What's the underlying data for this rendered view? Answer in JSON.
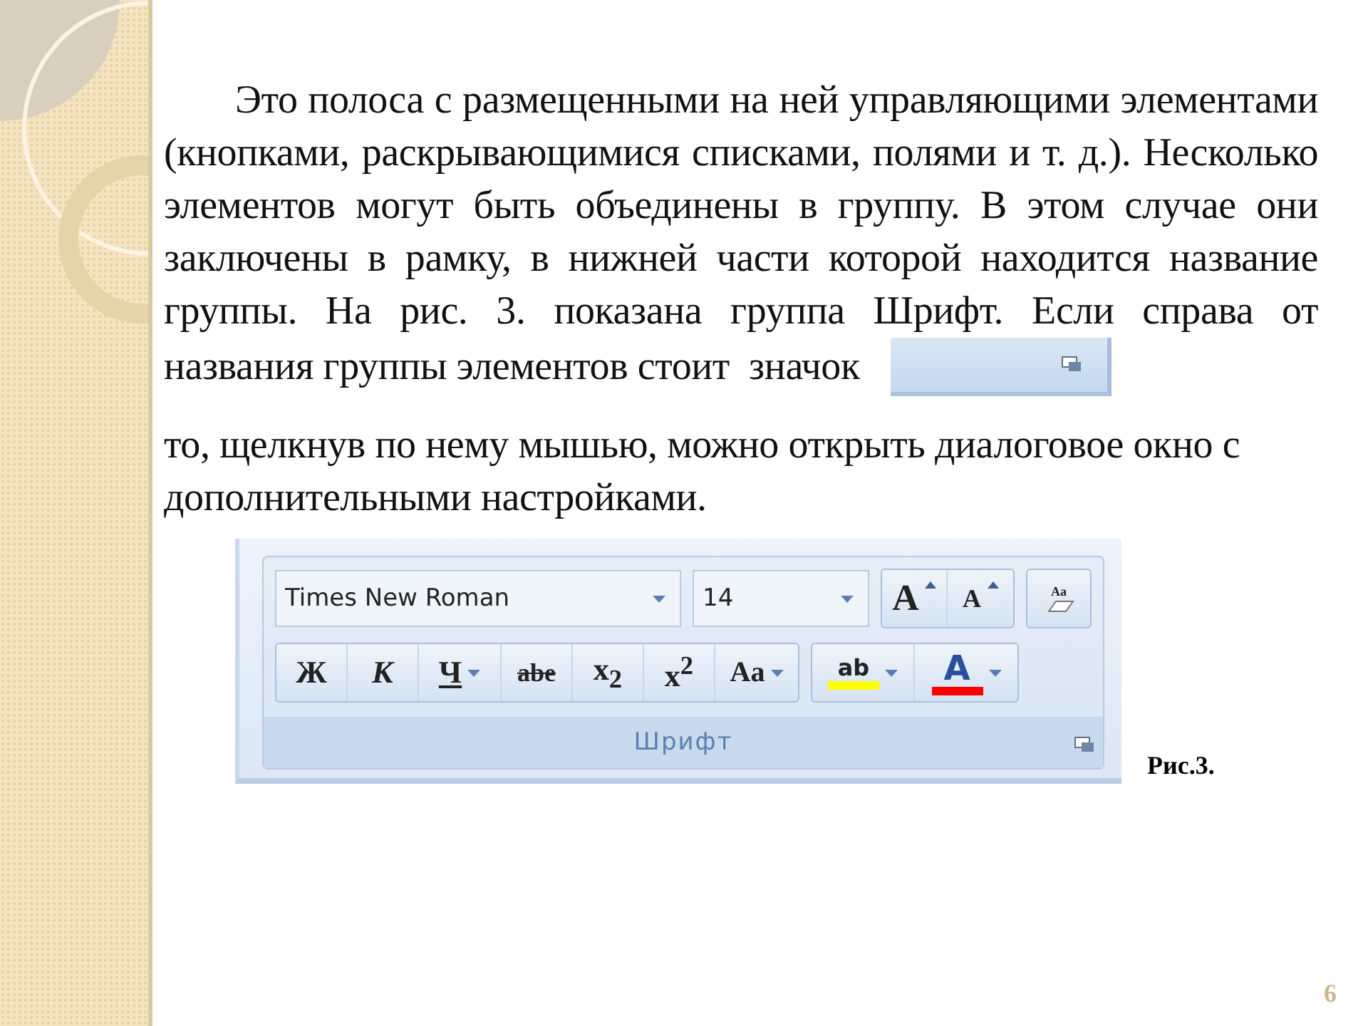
{
  "slide": {
    "paragraph_1": "Это полоса с размещенными на ней управляющими элементами (кнопками, раскрывающимися списками, полями и т. д.). Несколько элементов могут быть объединены в группу. В этом случае они заключены в рамку, в нижней части которой находится название группы. На рис. 3. показана группа Шрифт. Если справа от",
    "paragraph_1_end": "названия группы элементов стоит  значок",
    "paragraph_2": "то, щелкнув по нему мышью, можно открыть диалоговое окно с дополнительными настройками.",
    "caption": "Рис.3.",
    "page_number": "6"
  },
  "ribbon": {
    "font_name": "Times New Roman",
    "font_size": "14",
    "size_buttons": [
      {
        "label": "A",
        "kind": "grow"
      },
      {
        "label": "A",
        "kind": "shrink"
      }
    ],
    "clear_button": {
      "label": "Aa"
    },
    "format_buttons": [
      {
        "label": "Ж",
        "kind": "bold",
        "dropdown": false
      },
      {
        "label": "К",
        "kind": "italic",
        "dropdown": false
      },
      {
        "label": "Ч",
        "kind": "underline",
        "dropdown": true
      },
      {
        "label": "abe",
        "kind": "strike",
        "dropdown": false
      },
      {
        "label": "x$_{2}$",
        "kind": "sub",
        "dropdown": false
      },
      {
        "label": "x$^{2}$",
        "kind": "super",
        "dropdown": false
      },
      {
        "label": "Aa",
        "kind": "case",
        "dropdown": true
      }
    ],
    "color_buttons": [
      {
        "label": "ab",
        "kind": "highlight",
        "color": "#ffff00"
      },
      {
        "label": "A",
        "kind": "font_color",
        "color": "#ff0000"
      }
    ],
    "group_label": "Шрифт"
  }
}
